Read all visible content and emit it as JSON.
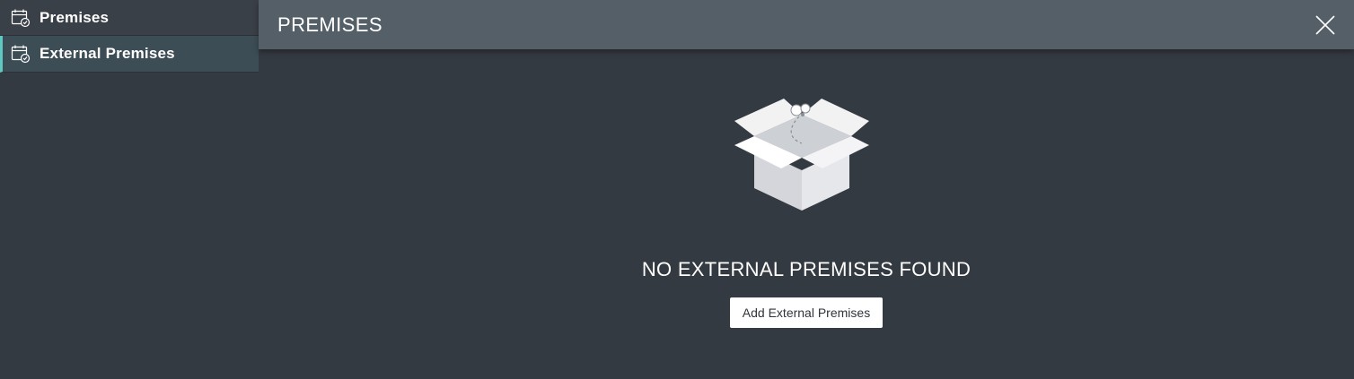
{
  "sidebar": {
    "items": [
      {
        "label": "Premises",
        "icon": "calendar-check-icon",
        "active": false
      },
      {
        "label": "External Premises",
        "icon": "calendar-check-icon",
        "active": true
      }
    ]
  },
  "header": {
    "title": "PREMISES",
    "close_icon": "close-icon"
  },
  "empty_state": {
    "illustration": "open-box-icon",
    "title": "NO EXTERNAL PREMISES FOUND",
    "button_label": "Add External Premises"
  },
  "colors": {
    "background": "#343a41",
    "header": "#555f68",
    "active_item": "#3d4d55",
    "accent": "#5fc8c1"
  }
}
